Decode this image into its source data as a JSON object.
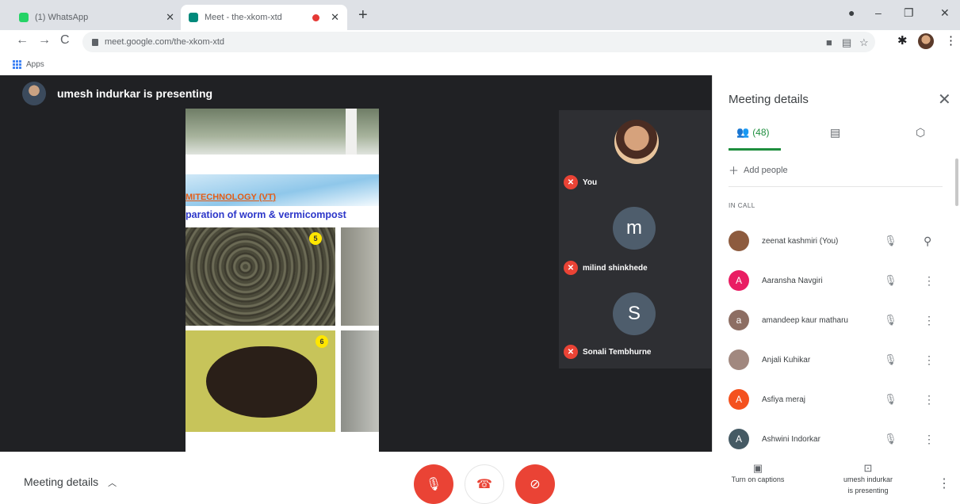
{
  "browser": {
    "tabs": [
      {
        "title": "(1) WhatsApp",
        "color": "#25d366"
      },
      {
        "title": "Meet - the-xkom-xtd",
        "color": "#00897b",
        "recording": true
      }
    ],
    "new_tab": "+",
    "url": "meet.google.com/the-xkom-xtd",
    "bookmarks_apps": "Apps"
  },
  "stage": {
    "presenter_text": "umesh indurkar is presenting",
    "slide": {
      "heading1": "MITECHNOLOGY (VT)",
      "heading2": "paration of worm & vermicompost",
      "badge1": "5",
      "badge2": "6"
    },
    "tiles": [
      {
        "label": "You"
      },
      {
        "letter": "m",
        "label": "milind shinkhede"
      },
      {
        "letter": "S",
        "label": "Sonali Tembhurne"
      }
    ]
  },
  "panel": {
    "title": "Meeting details",
    "people_count": "(48)",
    "add_people": "Add people",
    "in_call": "IN CALL",
    "participants": [
      {
        "name": "zeenat kashmiri (You)",
        "initial": "",
        "color": "#8d5b3e"
      },
      {
        "name": "Aaransha Navgiri",
        "initial": "A",
        "color": "#e91e63"
      },
      {
        "name": "amandeep kaur matharu",
        "initial": "a",
        "color": "#8d6e63"
      },
      {
        "name": "Anjali Kuhikar",
        "initial": "",
        "color": "#a1887f"
      },
      {
        "name": "Asfiya meraj",
        "initial": "A",
        "color": "#f4511e"
      },
      {
        "name": "Ashwini Indorkar",
        "initial": "A",
        "color": "#455a64"
      }
    ]
  },
  "bottom": {
    "meeting_details": "Meeting details",
    "captions": "Turn on captions",
    "presenting_line1": "umesh indurkar",
    "presenting_line2": "is presenting"
  }
}
